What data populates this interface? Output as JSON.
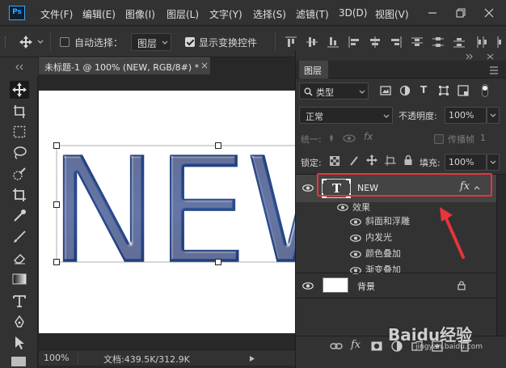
{
  "app": {
    "logo": "Ps"
  },
  "menu": [
    "文件(F)",
    "编辑(E)",
    "图像(I)",
    "图层(L)",
    "文字(Y)",
    "选择(S)",
    "滤镜(T)",
    "3D(D)",
    "视图(V)"
  ],
  "options": {
    "auto_select_label": "自动选择：",
    "auto_select_value": "图层",
    "show_transform_label": "显示变换控件"
  },
  "document": {
    "tab_title": "未标题-1 @ 100% (NEW, RGB/8#) *",
    "tab_close": "×",
    "canvas_text": "NEW",
    "zoom": "100%",
    "doc_info": "文档:439.5K/312.9K"
  },
  "layers_panel": {
    "title": "图层",
    "filter_label": "类型",
    "blend_mode": "正常",
    "opacity_label": "不透明度:",
    "opacity_value": "100%",
    "unify_label": "统一:",
    "propagate_label": "传播帧",
    "propagate_value": "1",
    "lock_label": "锁定:",
    "fill_label": "填充:",
    "fill_value": "100%",
    "layers": [
      {
        "name": "NEW",
        "thumb": "T",
        "fx": "fx"
      },
      {
        "name": "背景"
      }
    ],
    "effects_label": "效果",
    "effects": [
      "斜面和浮雕",
      "内发光",
      "颜色叠加",
      "渐变叠加"
    ]
  },
  "watermark": {
    "text": "Baidu经验",
    "url": "jingyan.baidu.com"
  },
  "colors": {
    "accent": "#31a8ff",
    "highlight": "#e8343a",
    "text_fill": "#1f3d7a"
  }
}
